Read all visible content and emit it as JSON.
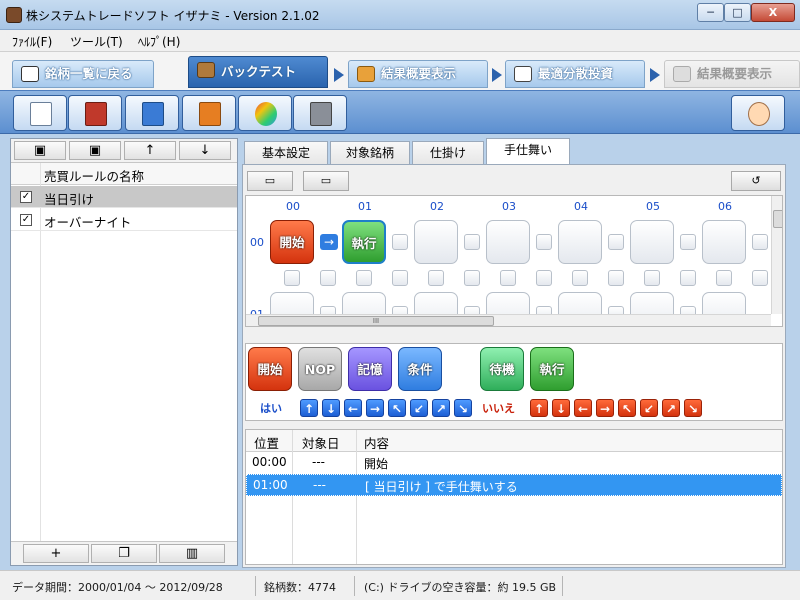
{
  "window": {
    "title": "株システムトレードソフト イザナミ - Version 2.1.02",
    "min": "─",
    "max": "□",
    "close": "X"
  },
  "menu": [
    "ﾌｧｲﾙ(F)",
    "ツール(T)",
    "ﾍﾙﾌﾟ(H)"
  ],
  "main_tabs": {
    "back": "銘柄一覧に戻る",
    "backtest": "バックテスト",
    "result1": "結果概要表示",
    "opt": "最適分散投資",
    "result2": "結果概要表示"
  },
  "left_panel": {
    "header": "売買ルールの名称",
    "rules": [
      {
        "name": "当日引け",
        "checked": "✓"
      },
      {
        "name": "オーバーナイト",
        "checked": "✓"
      }
    ]
  },
  "sub_tabs": [
    "基本設定",
    "対象銘柄",
    "仕掛け",
    "手仕舞い"
  ],
  "grid": {
    "columns": [
      "00",
      "01",
      "02",
      "03",
      "04",
      "05",
      "06"
    ],
    "rows": [
      "00",
      "01"
    ],
    "nodes": {
      "start": "開始",
      "exec": "執行"
    },
    "scroll_grip": "III"
  },
  "palette": {
    "buttons": [
      "開始",
      "NOP",
      "記憶",
      "条件",
      "待機",
      "執行"
    ],
    "yes": "はい",
    "no": "いいえ",
    "dirs": [
      "↑",
      "↓",
      "←",
      "→",
      "↖",
      "↙",
      "↗",
      "↘"
    ]
  },
  "log": {
    "headers": [
      "位置",
      "対象日",
      "内容"
    ],
    "rows": [
      {
        "pos": "00:00",
        "date": "---",
        "content": "開始"
      },
      {
        "pos": "01:00",
        "date": "---",
        "content": "[ 当日引け ] で手仕舞いする"
      }
    ]
  },
  "status": {
    "period": "データ期間：2000/01/04 〜 2012/09/28",
    "count": "銘柄数：4774",
    "disk": "(C:) ドライブの空き容量：約 19.5 GB"
  },
  "colors": {
    "start": "#e0481c",
    "nop": "#b5b5b5",
    "memory": "#7a64e8",
    "condition": "#3f8ff0",
    "wait": "#3fbf6a",
    "exec": "#3faa3f",
    "selected_row": "#3396f2"
  },
  "icons": {
    "left_tools": [
      "save-icon",
      "save-as-icon",
      "move-up-icon",
      "move-down-icon"
    ],
    "left_bottom": [
      "add-icon",
      "copy-icon",
      "trash-icon"
    ],
    "toolbar": [
      "new-file-icon",
      "calculator-icon",
      "export-icon",
      "import-icon",
      "palette-icon",
      "tools-icon",
      "help-icon"
    ]
  }
}
